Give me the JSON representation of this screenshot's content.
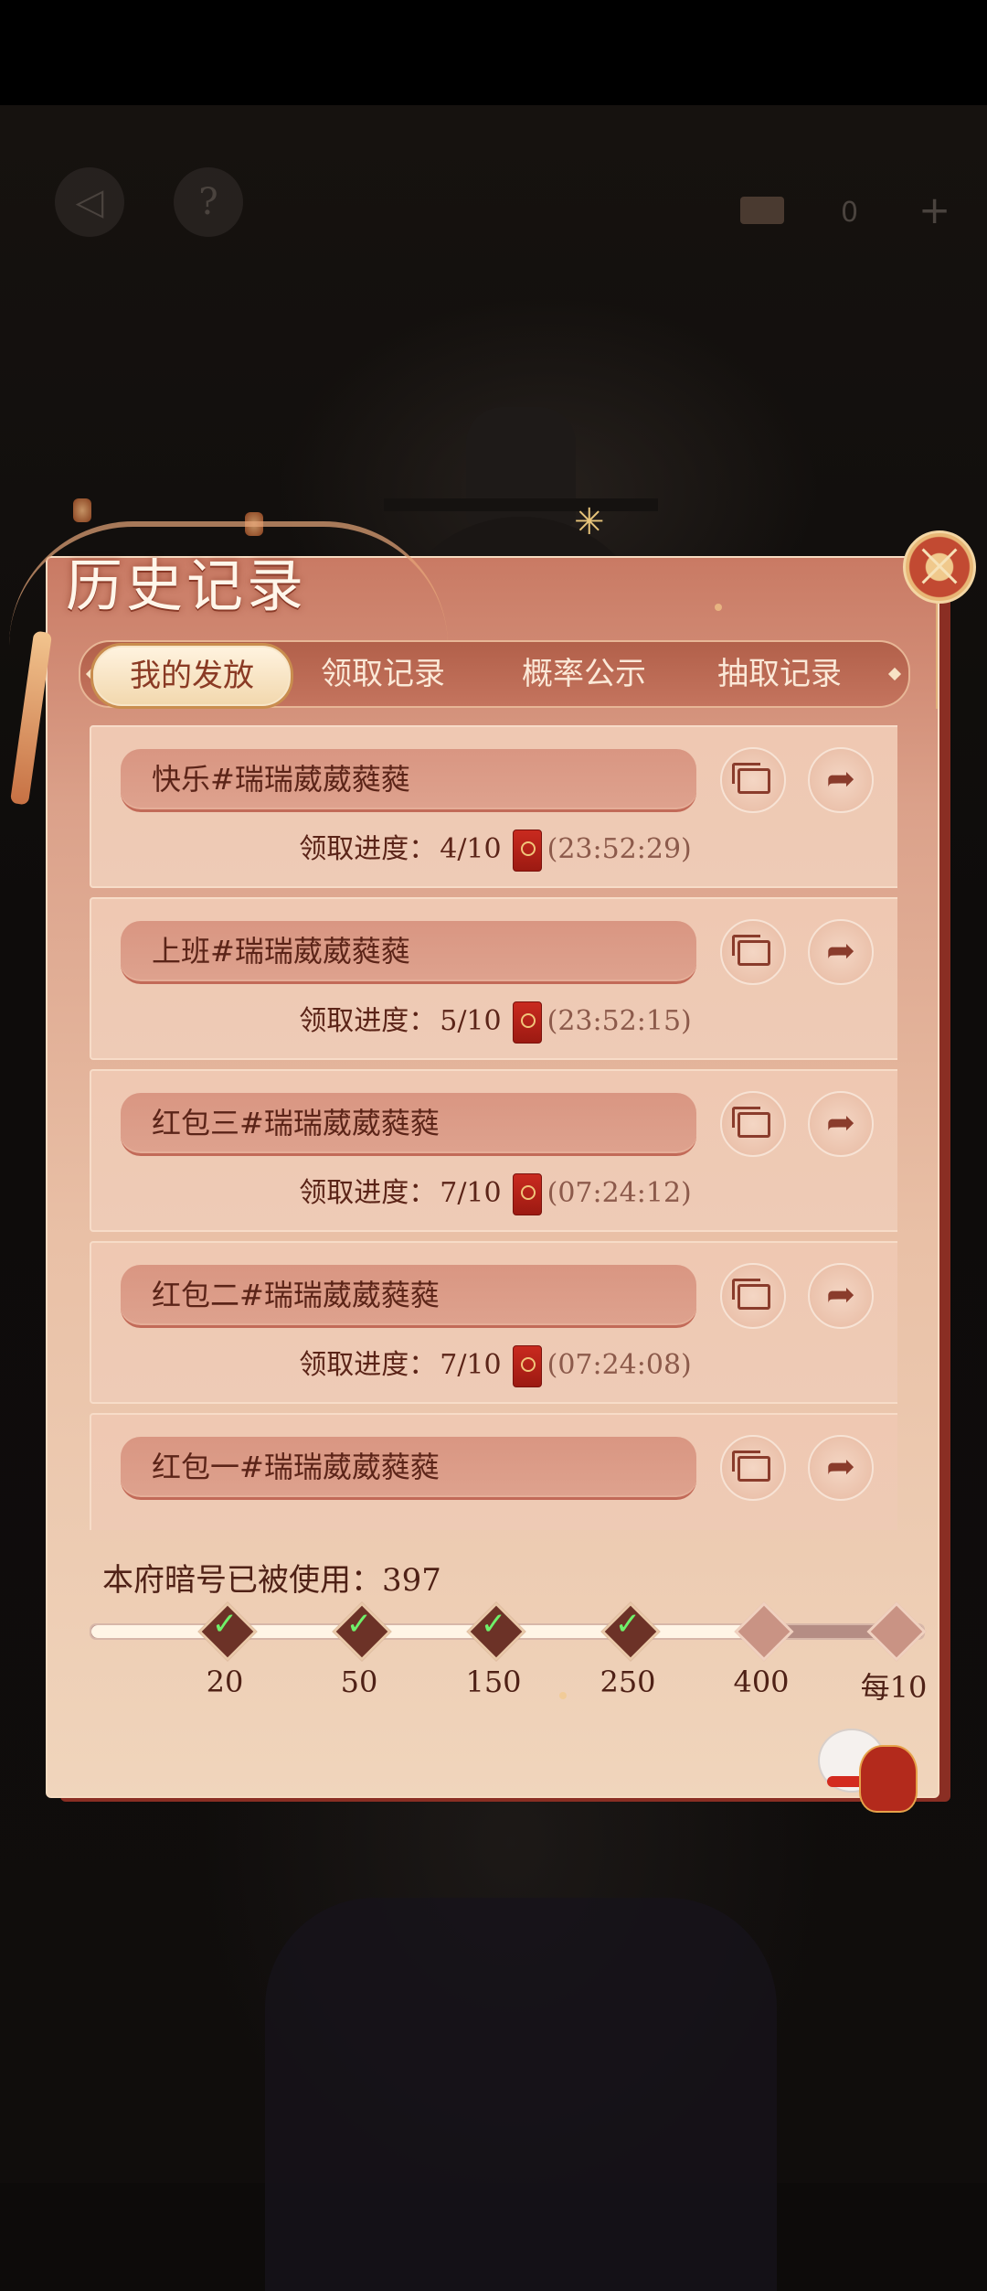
{
  "top_bar": {
    "back_icon": "back-arrow-icon",
    "help_label": "?",
    "currency_value": "0",
    "plus_label": "+"
  },
  "panel": {
    "title": "历史记录",
    "tabs": [
      {
        "label": "我的发放",
        "active": true
      },
      {
        "label": "领取记录",
        "active": false
      },
      {
        "label": "概率公示",
        "active": false
      },
      {
        "label": "抽取记录",
        "active": false
      }
    ],
    "records": [
      {
        "name": "快乐#瑞瑞葳葳蕤蕤",
        "progress_label": "领取进度：",
        "progress": "4/10",
        "time": "(23:52:29)"
      },
      {
        "name": "上班#瑞瑞葳葳蕤蕤",
        "progress_label": "领取进度：",
        "progress": "5/10",
        "time": "(23:52:15)"
      },
      {
        "name": "红包三#瑞瑞葳葳蕤蕤",
        "progress_label": "领取进度：",
        "progress": "7/10",
        "time": "(07:24:12)"
      },
      {
        "name": "红包二#瑞瑞葳葳蕤蕤",
        "progress_label": "领取进度：",
        "progress": "7/10",
        "time": "(07:24:08)"
      },
      {
        "name": "红包一#瑞瑞葳葳蕤蕤",
        "progress_label": "",
        "progress": "",
        "time": ""
      }
    ],
    "usage_text": "本府暗号已被使用：397",
    "milestones": [
      {
        "label": "20",
        "reached": true
      },
      {
        "label": "50",
        "reached": true
      },
      {
        "label": "150",
        "reached": true
      },
      {
        "label": "250",
        "reached": true
      },
      {
        "label": "400",
        "reached": false
      },
      {
        "label": "每10",
        "reached": false
      }
    ],
    "milestone_progress_fraction": 0.8
  },
  "colors": {
    "accent_red": "#c24a32",
    "check_green": "#6ff06a",
    "text_dark": "#5b2418"
  }
}
